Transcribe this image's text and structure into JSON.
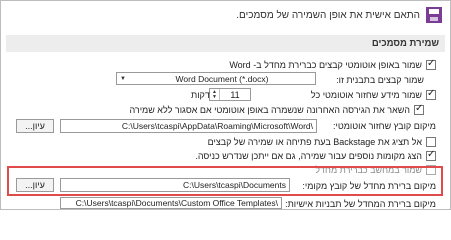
{
  "header": {
    "text": "התאם אישית את אופן השמירה של מסמכים."
  },
  "section": {
    "title": "שמירת מסמכים"
  },
  "rows": {
    "save_format_check": "שמור באופן אוטומטי קבצים כברירת מחדל ב- Word",
    "save_files_label": "שמור קבצים בתבנית זו:",
    "save_files_value": "Word Document (*.docx)",
    "autorecover_label": "שמור מידע שחזור אוטומטי כל",
    "autorecover_value": "11",
    "autorecover_unit": "דקות",
    "keep_last_version": "השאר את הגירסה האחרונה שנשמרה באופן אוטומטי אם אסגור ללא שמירה",
    "autorecover_location_label": "מיקום קובץ שחזור אוטומטי:",
    "autorecover_location_value": "C:\\Users\\tcaspi\\AppData\\Roaming\\Microsoft\\Word\\",
    "backstage_check": "אל תציג את Backstage בעת פתיחה או שמירה של קבצים",
    "additional_places_check": "הצג מקומות נוספים עבור שמירה, גם אם ייתכן שנדרש כניסה.",
    "save_to_computer_check": "שמור במחשב כברירת מחדל",
    "default_local_label": "מיקום ברירת מחדל של קובץ מקומי:",
    "default_local_value": "C:\\Users\\tcaspi\\Documents",
    "templates_label": "מיקום ברירת המחדל של תבניות אישיות:",
    "templates_value": "C:\\Users\\tcaspi\\Documents\\Custom Office Templates\\",
    "browse_label": "עיון..."
  },
  "colors": {
    "highlight": "#e04b4b",
    "icon": "#7a3c94"
  }
}
